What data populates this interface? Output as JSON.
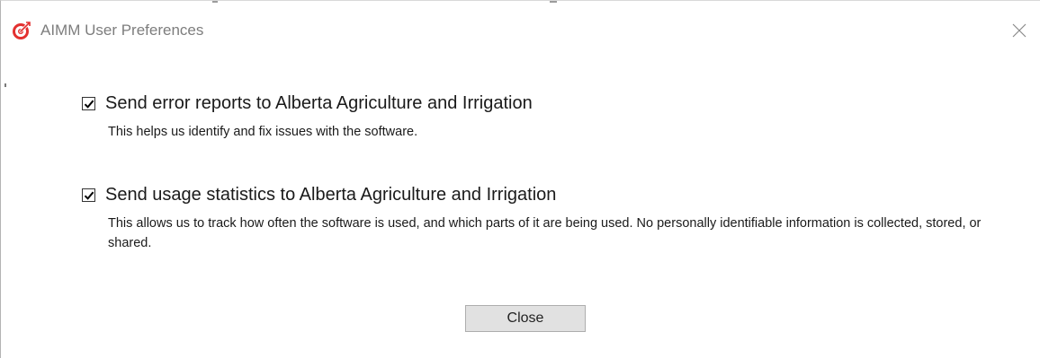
{
  "window": {
    "title": "AIMM User Preferences",
    "app_icon": "target-icon",
    "close_icon": "close-icon",
    "accent_color": "#e3302f"
  },
  "options": [
    {
      "checked": true,
      "label": "Send error reports to Alberta Agriculture and Irrigation",
      "description": "This helps us identify and fix issues with the software."
    },
    {
      "checked": true,
      "label": "Send usage statistics to Alberta Agriculture and Irrigation",
      "description": "This allows us to track how often the software is used, and which parts of it are being used. No personally identifiable information is collected, stored, or shared."
    }
  ],
  "buttons": {
    "close_label": "Close"
  }
}
